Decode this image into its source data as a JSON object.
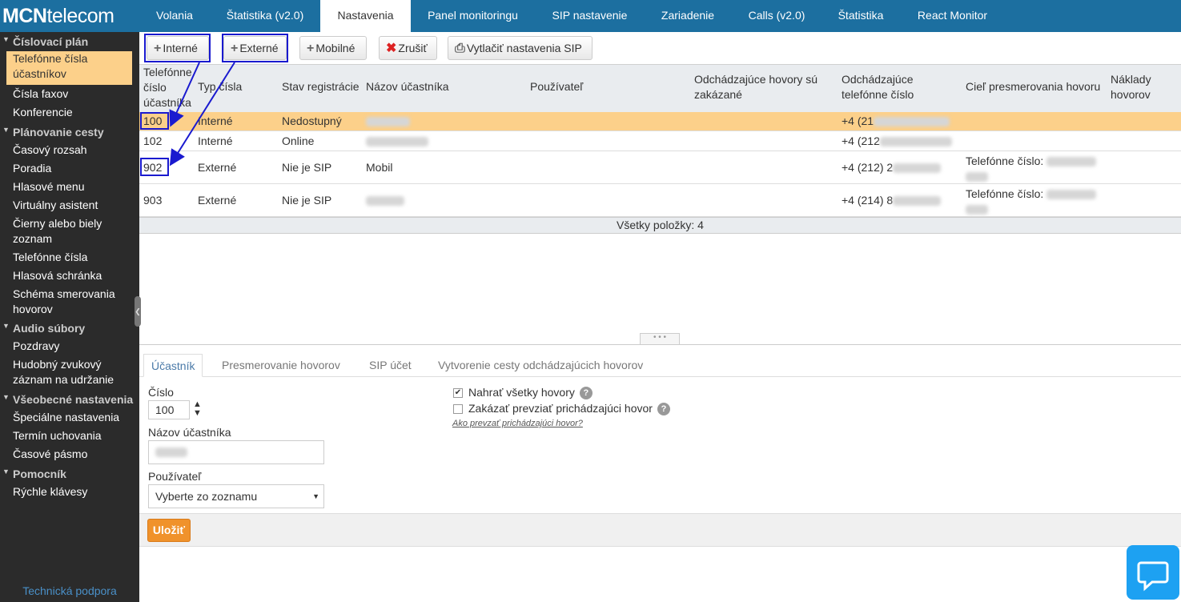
{
  "logo": {
    "bold": "MCN",
    "rest": "telecom"
  },
  "topnav": [
    "Volania",
    "Štatistika (v2.0)",
    "Nastavenia",
    "Panel monitoringu",
    "SIP nastavenie",
    "Zariadenie",
    "Calls (v2.0)",
    "Štatistika",
    "React Monitor"
  ],
  "topnav_active": "Nastavenia",
  "sidebar": {
    "sections": [
      "Číslovací plán",
      "Plánovanie cesty",
      "Audio súbory",
      "Všeobecné nastavenia",
      "Pomocník"
    ],
    "items": [
      "Telefónne čísla účastníkov",
      "Čísla faxov",
      "Konferencie",
      "Časový rozsah",
      "Poradia",
      "Hlasové menu",
      "Virtuálny asistent",
      "Čierny alebo biely zoznam",
      "Telefónne čísla",
      "Hlasová schránka",
      "Schéma smerovania hovorov",
      "Pozdravy",
      "Hudobný zvukový záznam na udržanie",
      "Špeciálne nastavenia",
      "Termín uchovania",
      "Časové pásmo",
      "Rýchle klávesy"
    ],
    "support": "Technická podpora"
  },
  "toolbar": {
    "internal": "Interné",
    "external": "Externé",
    "mobile": "Mobilné",
    "cancel": "Zrušiť",
    "print": "Vytlačiť nastavenia SIP"
  },
  "grid": {
    "headers": [
      "Telefónne číslo účastníka",
      "Typ čísla",
      "Stav registrácie",
      "Názov účastníka",
      "Používateľ",
      "Odchádzajúce hovory sú zakázané",
      "Odchádzajúce telefónne číslo",
      "Cieľ presmerovania hovoru",
      "Náklady hovorov"
    ],
    "rows": [
      {
        "number": "100",
        "type": "Interné",
        "status": "Nedostupný",
        "name": "",
        "user": "",
        "outgoing": "+4 (21",
        "redirect": ""
      },
      {
        "number": "102",
        "type": "Interné",
        "status": "Online",
        "name": "",
        "user": "",
        "outgoing": "+4 (212",
        "redirect": ""
      },
      {
        "number": "902",
        "type": "Externé",
        "status": "Nie je SIP",
        "name": "Mobil",
        "user": "",
        "outgoing": "+4 (212) 2",
        "redirect": "Telefónne číslo:"
      },
      {
        "number": "903",
        "type": "Externé",
        "status": "Nie je SIP",
        "name": "",
        "user": "",
        "outgoing": "+4 (214) 8",
        "redirect": "Telefónne číslo:"
      }
    ],
    "footer": "Všetky položky: 4"
  },
  "detail_tabs": [
    "Účastník",
    "Presmerovanie hovorov",
    "SIP účet",
    "Vytvorenie cesty odchádzajúcich hovorov"
  ],
  "form": {
    "number_label": "Číslo",
    "number_value": "100",
    "name_label": "Názov účastníka",
    "user_label": "Používateľ",
    "user_select": "Vyberte zo zoznamu",
    "record_label": "Nahrať všetky hovory",
    "forbid_label": "Zakázať prevziať prichádzajúci hovor",
    "how_link": "Ako prevzať prichádzajúci hovor?",
    "save": "Uložiť"
  }
}
